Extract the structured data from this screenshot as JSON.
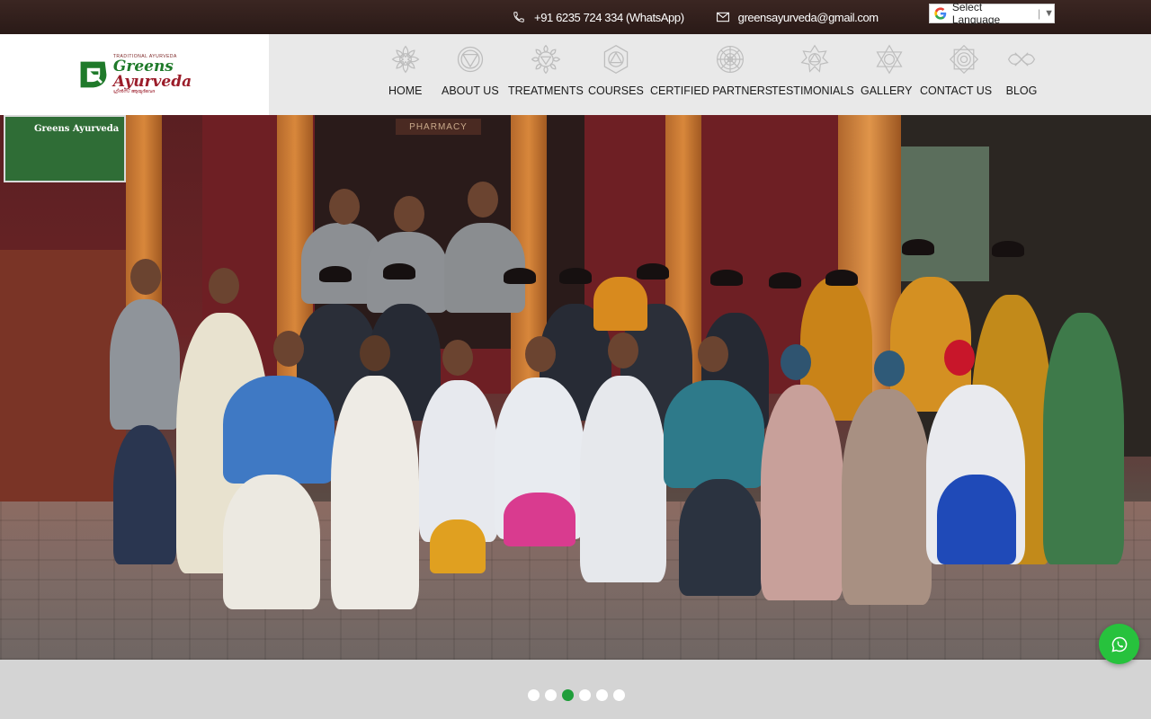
{
  "topbar": {
    "phone": "+91 6235 724 334 (WhatsApp)",
    "email": "greensayurveda@gmail.com",
    "language_label": "Select Language",
    "language_sep": "|",
    "language_caret": "▼"
  },
  "brand": {
    "tagline": "TRADITIONAL AYURVEDA",
    "name_part1": "Greens",
    "name_part2": "Ayurveda",
    "subline": "ഗ്രീൻസ് ആയുർവേദ",
    "colors": {
      "green": "#1f7a2a",
      "maroon": "#9b1d2a"
    }
  },
  "nav": {
    "items": [
      {
        "label": "HOME",
        "icon": "lotus-icon"
      },
      {
        "label": "ABOUT US",
        "icon": "triangle-chakra-icon"
      },
      {
        "label": "TREATMENTS",
        "icon": "petal-chakra-icon"
      },
      {
        "label": "COURSES",
        "icon": "heart-chakra-icon"
      },
      {
        "label": "CERTIFIED PARTNERS",
        "icon": "mandala-icon"
      },
      {
        "label": "TESTIMONIALS",
        "icon": "star-chakra-icon"
      },
      {
        "label": "GALLERY",
        "icon": "hexagram-icon"
      },
      {
        "label": "CONTACT US",
        "icon": "octagram-icon"
      },
      {
        "label": "BLOG",
        "icon": "infinity-knot-icon"
      }
    ]
  },
  "hero": {
    "sign_text": "Greens Ayurveda",
    "board_text": "PHARMACY",
    "slide_count": 6,
    "active_slide": 3
  },
  "whatsapp": {
    "icon": "whatsapp-icon",
    "color": "#27c23d"
  },
  "accent": "#1f9e3a"
}
